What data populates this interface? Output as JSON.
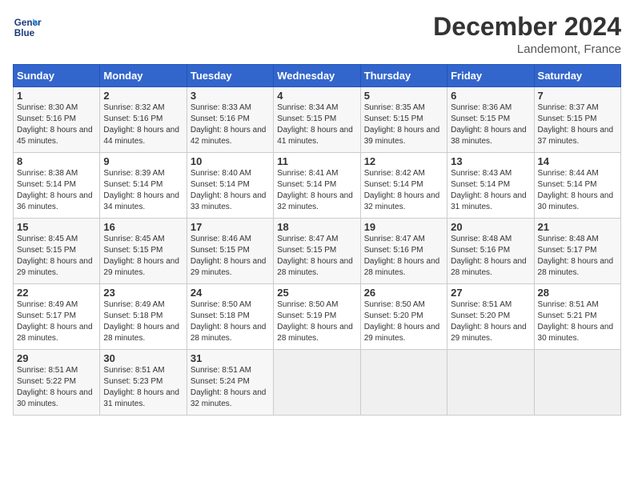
{
  "header": {
    "logo_line1": "General",
    "logo_line2": "Blue",
    "title": "December 2024",
    "location": "Landemont, France"
  },
  "days_of_week": [
    "Sunday",
    "Monday",
    "Tuesday",
    "Wednesday",
    "Thursday",
    "Friday",
    "Saturday"
  ],
  "weeks": [
    [
      {
        "day": "1",
        "sunrise": "Sunrise: 8:30 AM",
        "sunset": "Sunset: 5:16 PM",
        "daylight": "Daylight: 8 hours and 45 minutes."
      },
      {
        "day": "2",
        "sunrise": "Sunrise: 8:32 AM",
        "sunset": "Sunset: 5:16 PM",
        "daylight": "Daylight: 8 hours and 44 minutes."
      },
      {
        "day": "3",
        "sunrise": "Sunrise: 8:33 AM",
        "sunset": "Sunset: 5:16 PM",
        "daylight": "Daylight: 8 hours and 42 minutes."
      },
      {
        "day": "4",
        "sunrise": "Sunrise: 8:34 AM",
        "sunset": "Sunset: 5:15 PM",
        "daylight": "Daylight: 8 hours and 41 minutes."
      },
      {
        "day": "5",
        "sunrise": "Sunrise: 8:35 AM",
        "sunset": "Sunset: 5:15 PM",
        "daylight": "Daylight: 8 hours and 39 minutes."
      },
      {
        "day": "6",
        "sunrise": "Sunrise: 8:36 AM",
        "sunset": "Sunset: 5:15 PM",
        "daylight": "Daylight: 8 hours and 38 minutes."
      },
      {
        "day": "7",
        "sunrise": "Sunrise: 8:37 AM",
        "sunset": "Sunset: 5:15 PM",
        "daylight": "Daylight: 8 hours and 37 minutes."
      }
    ],
    [
      {
        "day": "8",
        "sunrise": "Sunrise: 8:38 AM",
        "sunset": "Sunset: 5:14 PM",
        "daylight": "Daylight: 8 hours and 36 minutes."
      },
      {
        "day": "9",
        "sunrise": "Sunrise: 8:39 AM",
        "sunset": "Sunset: 5:14 PM",
        "daylight": "Daylight: 8 hours and 34 minutes."
      },
      {
        "day": "10",
        "sunrise": "Sunrise: 8:40 AM",
        "sunset": "Sunset: 5:14 PM",
        "daylight": "Daylight: 8 hours and 33 minutes."
      },
      {
        "day": "11",
        "sunrise": "Sunrise: 8:41 AM",
        "sunset": "Sunset: 5:14 PM",
        "daylight": "Daylight: 8 hours and 32 minutes."
      },
      {
        "day": "12",
        "sunrise": "Sunrise: 8:42 AM",
        "sunset": "Sunset: 5:14 PM",
        "daylight": "Daylight: 8 hours and 32 minutes."
      },
      {
        "day": "13",
        "sunrise": "Sunrise: 8:43 AM",
        "sunset": "Sunset: 5:14 PM",
        "daylight": "Daylight: 8 hours and 31 minutes."
      },
      {
        "day": "14",
        "sunrise": "Sunrise: 8:44 AM",
        "sunset": "Sunset: 5:14 PM",
        "daylight": "Daylight: 8 hours and 30 minutes."
      }
    ],
    [
      {
        "day": "15",
        "sunrise": "Sunrise: 8:45 AM",
        "sunset": "Sunset: 5:15 PM",
        "daylight": "Daylight: 8 hours and 29 minutes."
      },
      {
        "day": "16",
        "sunrise": "Sunrise: 8:45 AM",
        "sunset": "Sunset: 5:15 PM",
        "daylight": "Daylight: 8 hours and 29 minutes."
      },
      {
        "day": "17",
        "sunrise": "Sunrise: 8:46 AM",
        "sunset": "Sunset: 5:15 PM",
        "daylight": "Daylight: 8 hours and 29 minutes."
      },
      {
        "day": "18",
        "sunrise": "Sunrise: 8:47 AM",
        "sunset": "Sunset: 5:15 PM",
        "daylight": "Daylight: 8 hours and 28 minutes."
      },
      {
        "day": "19",
        "sunrise": "Sunrise: 8:47 AM",
        "sunset": "Sunset: 5:16 PM",
        "daylight": "Daylight: 8 hours and 28 minutes."
      },
      {
        "day": "20",
        "sunrise": "Sunrise: 8:48 AM",
        "sunset": "Sunset: 5:16 PM",
        "daylight": "Daylight: 8 hours and 28 minutes."
      },
      {
        "day": "21",
        "sunrise": "Sunrise: 8:48 AM",
        "sunset": "Sunset: 5:17 PM",
        "daylight": "Daylight: 8 hours and 28 minutes."
      }
    ],
    [
      {
        "day": "22",
        "sunrise": "Sunrise: 8:49 AM",
        "sunset": "Sunset: 5:17 PM",
        "daylight": "Daylight: 8 hours and 28 minutes."
      },
      {
        "day": "23",
        "sunrise": "Sunrise: 8:49 AM",
        "sunset": "Sunset: 5:18 PM",
        "daylight": "Daylight: 8 hours and 28 minutes."
      },
      {
        "day": "24",
        "sunrise": "Sunrise: 8:50 AM",
        "sunset": "Sunset: 5:18 PM",
        "daylight": "Daylight: 8 hours and 28 minutes."
      },
      {
        "day": "25",
        "sunrise": "Sunrise: 8:50 AM",
        "sunset": "Sunset: 5:19 PM",
        "daylight": "Daylight: 8 hours and 28 minutes."
      },
      {
        "day": "26",
        "sunrise": "Sunrise: 8:50 AM",
        "sunset": "Sunset: 5:20 PM",
        "daylight": "Daylight: 8 hours and 29 minutes."
      },
      {
        "day": "27",
        "sunrise": "Sunrise: 8:51 AM",
        "sunset": "Sunset: 5:20 PM",
        "daylight": "Daylight: 8 hours and 29 minutes."
      },
      {
        "day": "28",
        "sunrise": "Sunrise: 8:51 AM",
        "sunset": "Sunset: 5:21 PM",
        "daylight": "Daylight: 8 hours and 30 minutes."
      }
    ],
    [
      {
        "day": "29",
        "sunrise": "Sunrise: 8:51 AM",
        "sunset": "Sunset: 5:22 PM",
        "daylight": "Daylight: 8 hours and 30 minutes."
      },
      {
        "day": "30",
        "sunrise": "Sunrise: 8:51 AM",
        "sunset": "Sunset: 5:23 PM",
        "daylight": "Daylight: 8 hours and 31 minutes."
      },
      {
        "day": "31",
        "sunrise": "Sunrise: 8:51 AM",
        "sunset": "Sunset: 5:24 PM",
        "daylight": "Daylight: 8 hours and 32 minutes."
      },
      null,
      null,
      null,
      null
    ]
  ]
}
